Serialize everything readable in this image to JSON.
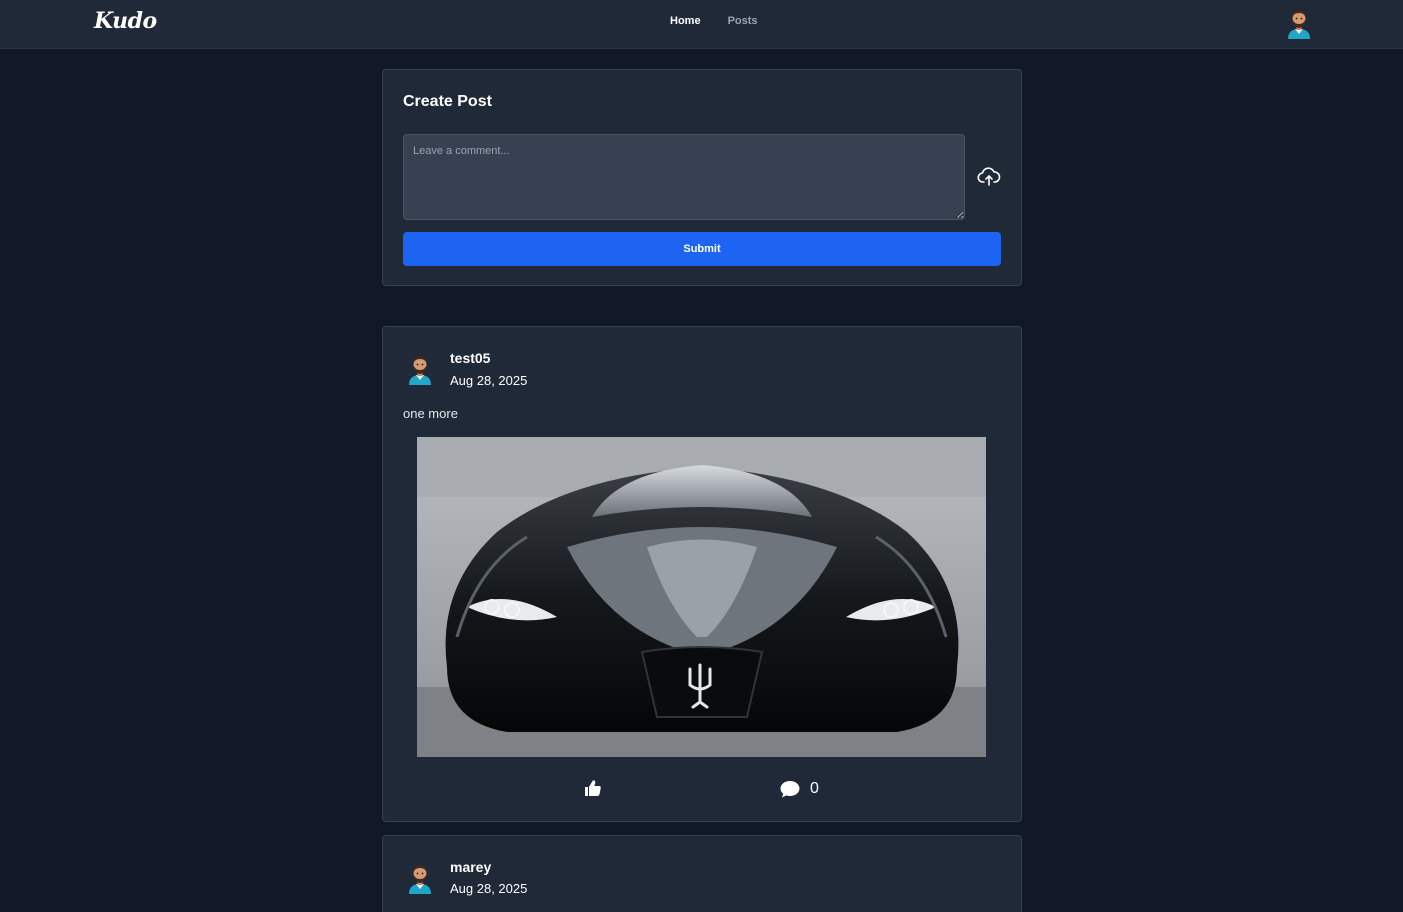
{
  "app": {
    "logo": "Kudo"
  },
  "nav": {
    "links": [
      {
        "label": "Home",
        "active": true
      },
      {
        "label": "Posts",
        "active": false
      }
    ]
  },
  "create_post": {
    "title": "Create Post",
    "comment_placeholder": "Leave a comment...",
    "comment_value": "",
    "submit_label": "Submit",
    "upload_icon": "cloud-upload-icon"
  },
  "posts": [
    {
      "username": "test05",
      "date": "Aug 28, 2025",
      "text": "one more",
      "image": "car-photo",
      "like_icon": "thumbs-up-icon",
      "comment_icon": "comment-icon",
      "comment_count": "0"
    },
    {
      "username": "marey",
      "date": "Aug 28, 2025"
    }
  ],
  "colors": {
    "background": "#111827",
    "card": "#1f2937",
    "accent": "#1d64f2",
    "input": "#374151"
  }
}
